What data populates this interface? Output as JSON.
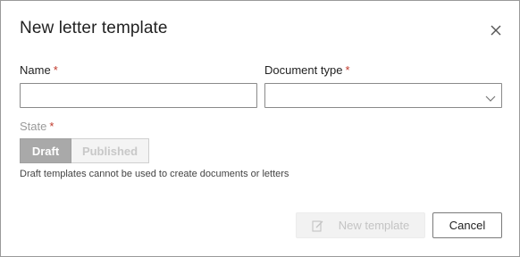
{
  "dialog": {
    "title": "New letter template",
    "close_icon": "close-icon"
  },
  "form": {
    "name": {
      "label": "Name",
      "required_mark": "*",
      "value": ""
    },
    "document_type": {
      "label": "Document type",
      "required_mark": "*",
      "selected_value": "",
      "icon": "chevron-down-icon"
    },
    "state": {
      "label": "State",
      "required_mark": "*",
      "options": [
        "Draft",
        "Published"
      ],
      "selected": "Draft",
      "hint": "Draft templates cannot be used to create documents or letters"
    }
  },
  "actions": {
    "new_template_label": "New template",
    "new_template_icon": "edit-icon",
    "new_template_enabled": false,
    "cancel_label": "Cancel"
  },
  "colors": {
    "required": "#c0392b",
    "segment_active": "#a9a9a9",
    "disabled_button": "#f2f2f2"
  }
}
